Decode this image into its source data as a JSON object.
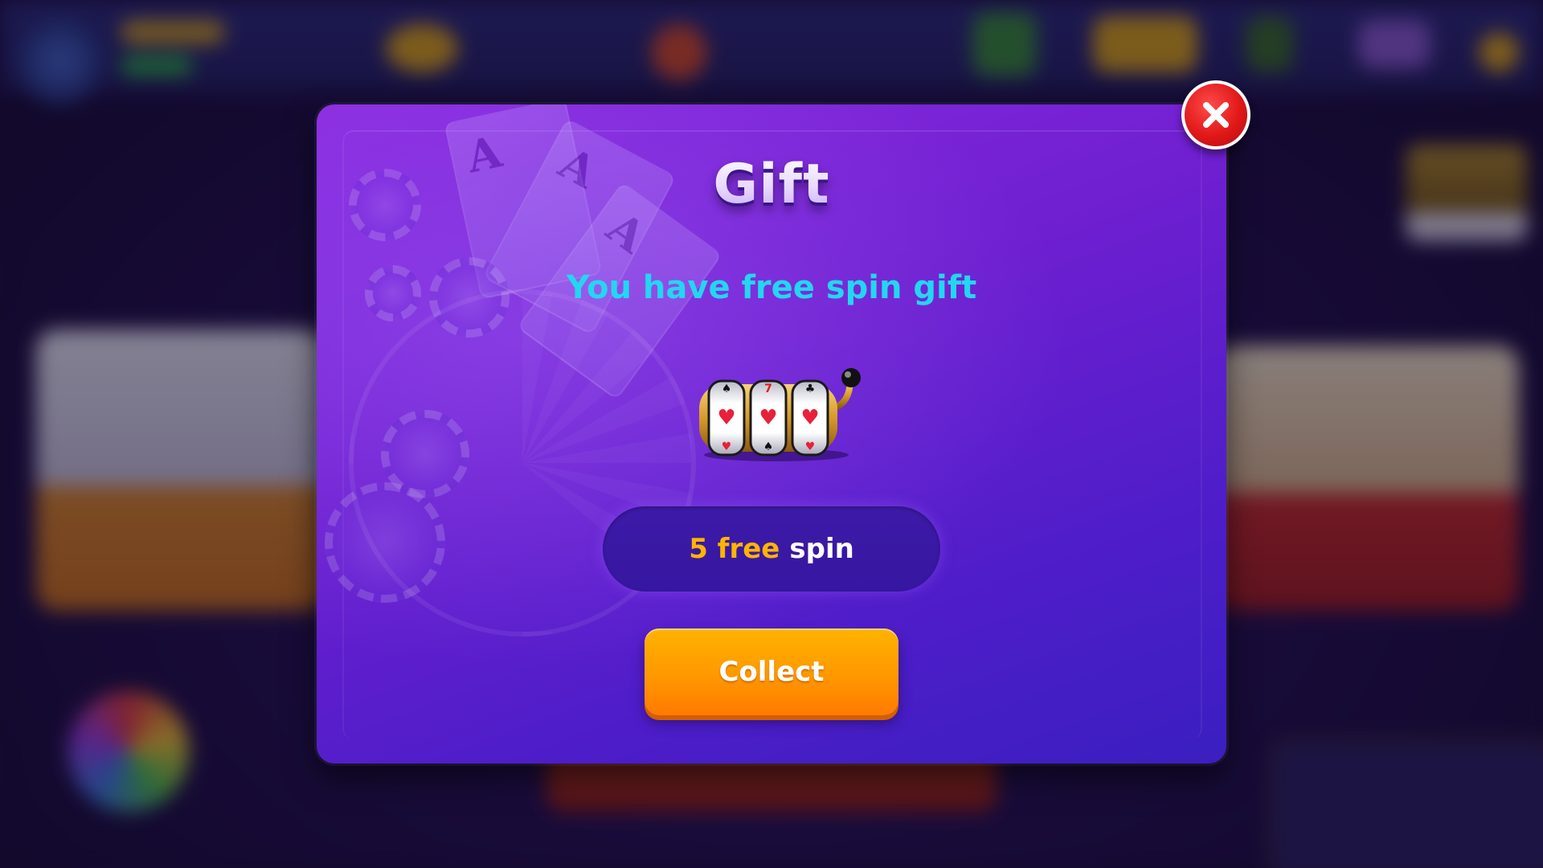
{
  "dialog": {
    "title": "Gift",
    "message": "You have free spin gift",
    "reward": {
      "count": "5 free",
      "unit": "spin"
    },
    "collect_label": "Collect",
    "icons": {
      "close": "close-x-icon",
      "reward": "slot-machine-icon"
    }
  },
  "theme": {
    "modal_top": "#8a2be0",
    "modal_bottom": "#3a1fc0",
    "subtitle": "#23d6f2",
    "reward_count": "#ffb400",
    "collect_button": "#ff9800",
    "close_button": "#e01818"
  }
}
